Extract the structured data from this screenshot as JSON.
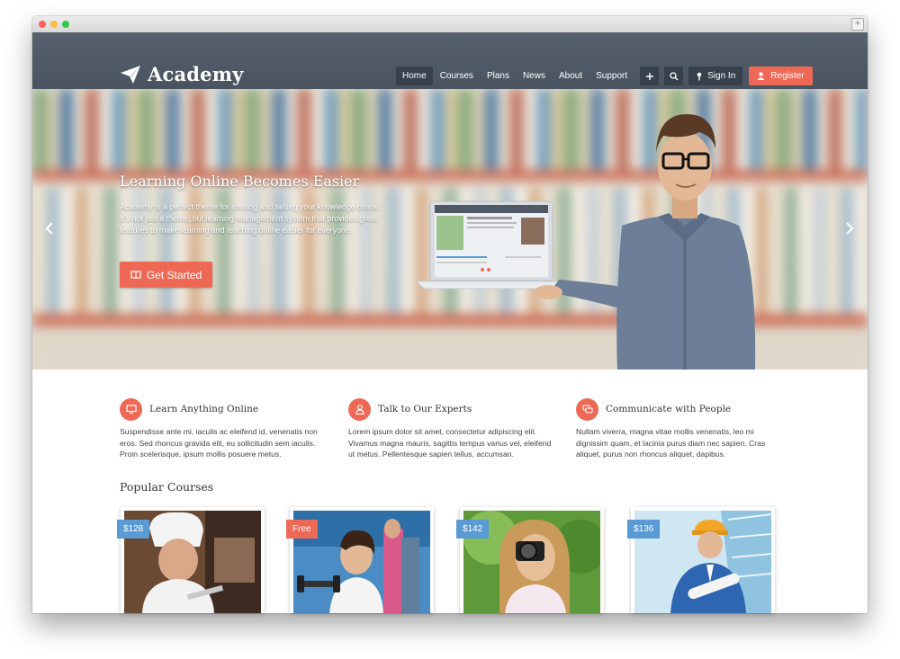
{
  "brand": {
    "name": "Academy"
  },
  "nav": {
    "items": [
      {
        "label": "Home",
        "active": true
      },
      {
        "label": "Courses"
      },
      {
        "label": "Plans"
      },
      {
        "label": "News"
      },
      {
        "label": "About"
      },
      {
        "label": "Support"
      }
    ],
    "signin_label": "Sign In",
    "register_label": "Register"
  },
  "hero": {
    "title": "Learning Online Becomes Easier",
    "text": "Academy is a perfect theme for sharing and selling your knowledge online. It's not just a theme, but learning management system that provides great features to make learning and teaching online easier for everyone.",
    "cta_label": "Get Started"
  },
  "features": [
    {
      "title": "Learn Anything Online",
      "icon": "monitor-icon",
      "text": "Suspendisse ante mi, iaculis ac eleifend id, venenatis non eros. Sed rhoncus gravida elit, eu sollicitudin sem iaculis. Proin scelerisque, ipsum mollis posuere metus."
    },
    {
      "title": "Talk to Our Experts",
      "icon": "person-icon",
      "text": "Lorem ipsum dolor sit amet, consectetur adipiscing elit. Vivamus magna mauris, sagittis tempus varius vel, eleifend ut metus. Pellentesque sapien tellus, accumsan."
    },
    {
      "title": "Communicate with People",
      "icon": "chat-icon",
      "text": "Nullam viverra, magna vitae mollis venenatis, leo mi dignissim quam, et lacinia purus diam nec sapien. Cras aliquet, purus non rhoncus aliquet, dapibus."
    }
  ],
  "popular": {
    "title": "Popular Courses",
    "courses": [
      {
        "price": "$128",
        "type": "paid"
      },
      {
        "price": "Free",
        "type": "free"
      },
      {
        "price": "$142",
        "type": "paid"
      },
      {
        "price": "$136",
        "type": "paid"
      }
    ]
  },
  "colors": {
    "accent": "#ee6955",
    "header": "#4e5965",
    "price_badge": "#5b9bd5"
  }
}
